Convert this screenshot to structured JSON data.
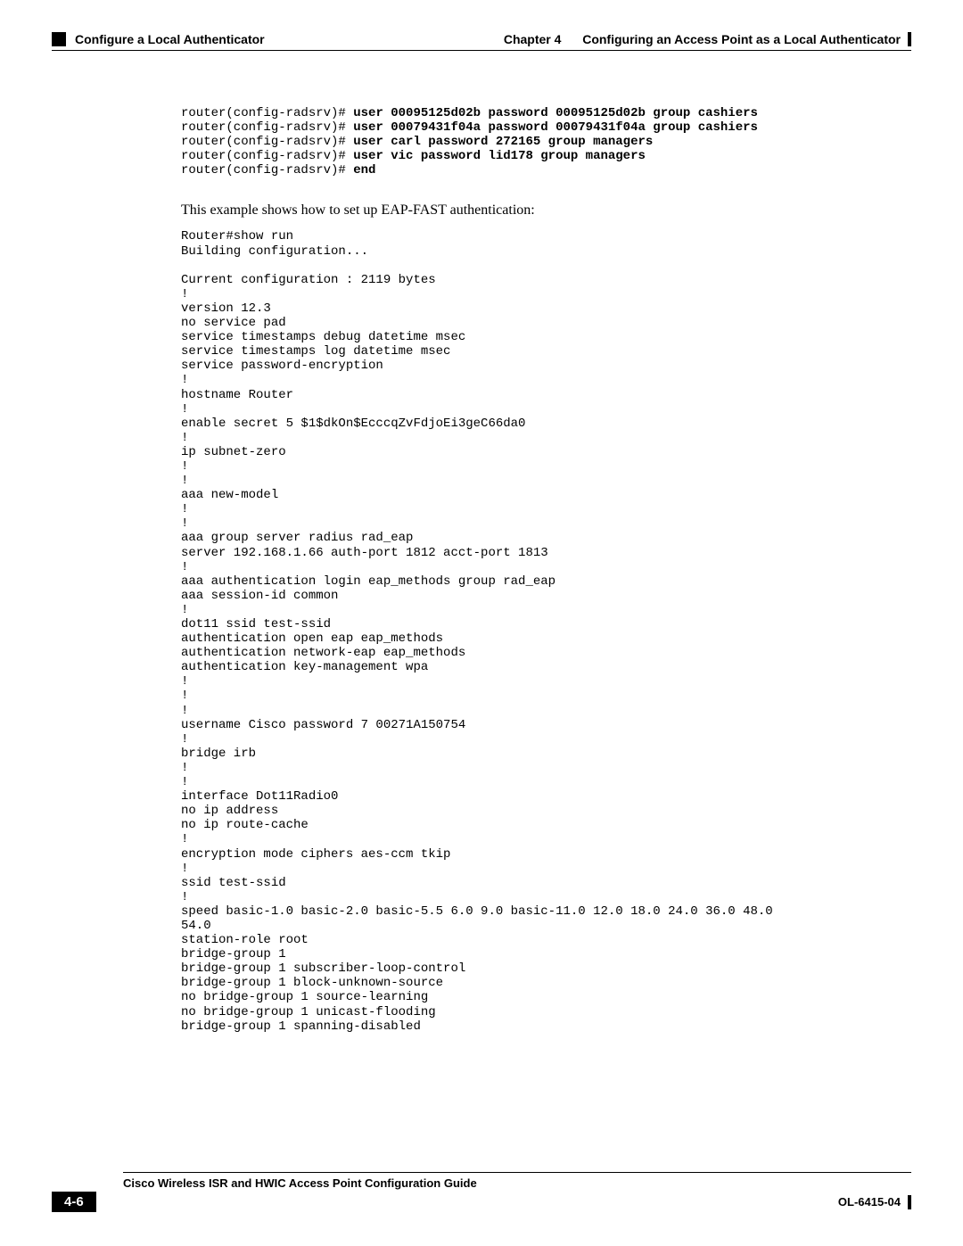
{
  "header": {
    "section_title": "Configure a Local Authenticator",
    "chapter_label": "Chapter 4",
    "chapter_title": "Configuring an Access Point as a Local Authenticator"
  },
  "code1": {
    "p1": "router(config-radsrv)# ",
    "b1": "user 00095125d02b password 00095125d02b group cashiers",
    "p2": "router(config-radsrv)# ",
    "b2": "user 00079431f04a password 00079431f04a group cashiers",
    "p3": "router(config-radsrv)# ",
    "b3": "user carl password 272165 group managers",
    "p4": "router(config-radsrv)# ",
    "b4": "user vic password lid178 group managers",
    "p5": "router(config-radsrv)# ",
    "b5": "end"
  },
  "narrative_text": "This example shows how to set up EAP-FAST authentication:",
  "code2": "Router#show run\nBuilding configuration...\n\nCurrent configuration : 2119 bytes\n!\nversion 12.3\nno service pad\nservice timestamps debug datetime msec\nservice timestamps log datetime msec\nservice password-encryption\n!\nhostname Router\n!\nenable secret 5 $1$dkOn$EcccqZvFdjoEi3geC66da0\n!\nip subnet-zero\n!\n!\naaa new-model\n!\n!\naaa group server radius rad_eap\nserver 192.168.1.66 auth-port 1812 acct-port 1813\n!\naaa authentication login eap_methods group rad_eap\naaa session-id common\n!\ndot11 ssid test-ssid\nauthentication open eap eap_methods\nauthentication network-eap eap_methods\nauthentication key-management wpa\n!\n!\n!\nusername Cisco password 7 00271A150754\n!\nbridge irb\n!\n!\ninterface Dot11Radio0\nno ip address\nno ip route-cache\n!\nencryption mode ciphers aes-ccm tkip\n!\nssid test-ssid\n!\nspeed basic-1.0 basic-2.0 basic-5.5 6.0 9.0 basic-11.0 12.0 18.0 24.0 36.0 48.0 \n54.0\nstation-role root\nbridge-group 1\nbridge-group 1 subscriber-loop-control\nbridge-group 1 block-unknown-source\nno bridge-group 1 source-learning\nno bridge-group 1 unicast-flooding\nbridge-group 1 spanning-disabled",
  "footer": {
    "guide_title": "Cisco Wireless ISR and HWIC Access Point Configuration Guide",
    "page_number": "4-6",
    "doc_id": "OL-6415-04"
  }
}
